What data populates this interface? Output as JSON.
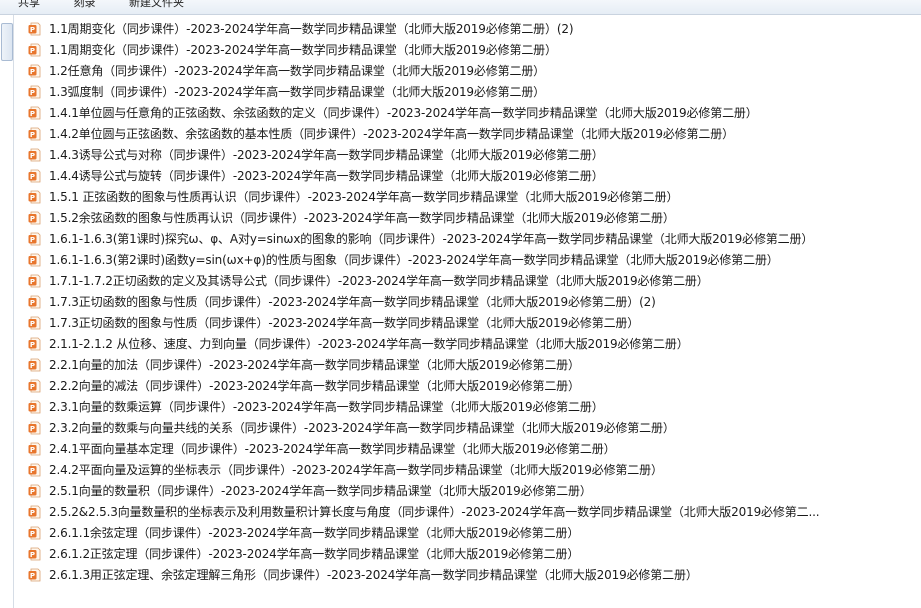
{
  "toolbar": {
    "items": [
      "共享",
      "刻录",
      "新建文件夹"
    ]
  },
  "files": [
    "1.1周期变化（同步课件）-2023-2024学年高一数学同步精品课堂（北师大版2019必修第二册）(2)",
    "1.1周期变化（同步课件）-2023-2024学年高一数学同步精品课堂（北师大版2019必修第二册）",
    "1.2任意角（同步课件）-2023-2024学年高一数学同步精品课堂（北师大版2019必修第二册）",
    "1.3弧度制（同步课件）-2023-2024学年高一数学同步精品课堂（北师大版2019必修第二册）",
    "1.4.1单位圆与任意角的正弦函数、余弦函数的定义（同步课件）-2023-2024学年高一数学同步精品课堂（北师大版2019必修第二册）",
    "1.4.2单位圆与正弦函数、余弦函数的基本性质（同步课件）-2023-2024学年高一数学同步精品课堂（北师大版2019必修第二册）",
    "1.4.3诱导公式与对称（同步课件）-2023-2024学年高一数学同步精品课堂（北师大版2019必修第二册）",
    "1.4.4诱导公式与旋转（同步课件）-2023-2024学年高一数学同步精品课堂（北师大版2019必修第二册）",
    "1.5.1 正弦函数的图象与性质再认识（同步课件）-2023-2024学年高一数学同步精品课堂（北师大版2019必修第二册）",
    "1.5.2余弦函数的图象与性质再认识（同步课件）-2023-2024学年高一数学同步精品课堂（北师大版2019必修第二册）",
    "1.6.1-1.6.3(第1课时)探究ω、φ、A对y=sinωx的图象的影响（同步课件）-2023-2024学年高一数学同步精品课堂（北师大版2019必修第二册）",
    "1.6.1-1.6.3(第2课时)函数y=sin(ωx+φ)的性质与图象（同步课件）-2023-2024学年高一数学同步精品课堂（北师大版2019必修第二册）",
    "1.7.1-1.7.2正切函数的定义及其诱导公式（同步课件）-2023-2024学年高一数学同步精品课堂（北师大版2019必修第二册）",
    "1.7.3正切函数的图象与性质（同步课件）-2023-2024学年高一数学同步精品课堂（北师大版2019必修第二册）(2)",
    "1.7.3正切函数的图象与性质（同步课件）-2023-2024学年高一数学同步精品课堂（北师大版2019必修第二册）",
    "2.1.1-2.1.2 从位移、速度、力到向量（同步课件）-2023-2024学年高一数学同步精品课堂（北师大版2019必修第二册）",
    "2.2.1向量的加法（同步课件）-2023-2024学年高一数学同步精品课堂（北师大版2019必修第二册）",
    "2.2.2向量的减法（同步课件）-2023-2024学年高一数学同步精品课堂（北师大版2019必修第二册）",
    "2.3.1向量的数乘运算（同步课件）-2023-2024学年高一数学同步精品课堂（北师大版2019必修第二册）",
    "2.3.2向量的数乘与向量共线的关系（同步课件）-2023-2024学年高一数学同步精品课堂（北师大版2019必修第二册）",
    "2.4.1平面向量基本定理（同步课件）-2023-2024学年高一数学同步精品课堂（北师大版2019必修第二册）",
    "2.4.2平面向量及运算的坐标表示（同步课件）-2023-2024学年高一数学同步精品课堂（北师大版2019必修第二册）",
    "2.5.1向量的数量积（同步课件）-2023-2024学年高一数学同步精品课堂（北师大版2019必修第二册）",
    "2.5.2&2.5.3向量数量积的坐标表示及利用数量积计算长度与角度（同步课件）-2023-2024学年高一数学同步精品课堂（北师大版2019必修第二...",
    "2.6.1.1余弦定理（同步课件）-2023-2024学年高一数学同步精品课堂（北师大版2019必修第二册）",
    "2.6.1.2正弦定理（同步课件）-2023-2024学年高一数学同步精品课堂（北师大版2019必修第二册）",
    "2.6.1.3用正弦定理、余弦定理解三角形（同步课件）-2023-2024学年高一数学同步精品课堂（北师大版2019必修第二册）"
  ],
  "colors": {
    "ppt_icon_orange": "#e8762d",
    "ppt_icon_letter": "#ffffff"
  },
  "icon_name": "powerpoint-file-icon"
}
